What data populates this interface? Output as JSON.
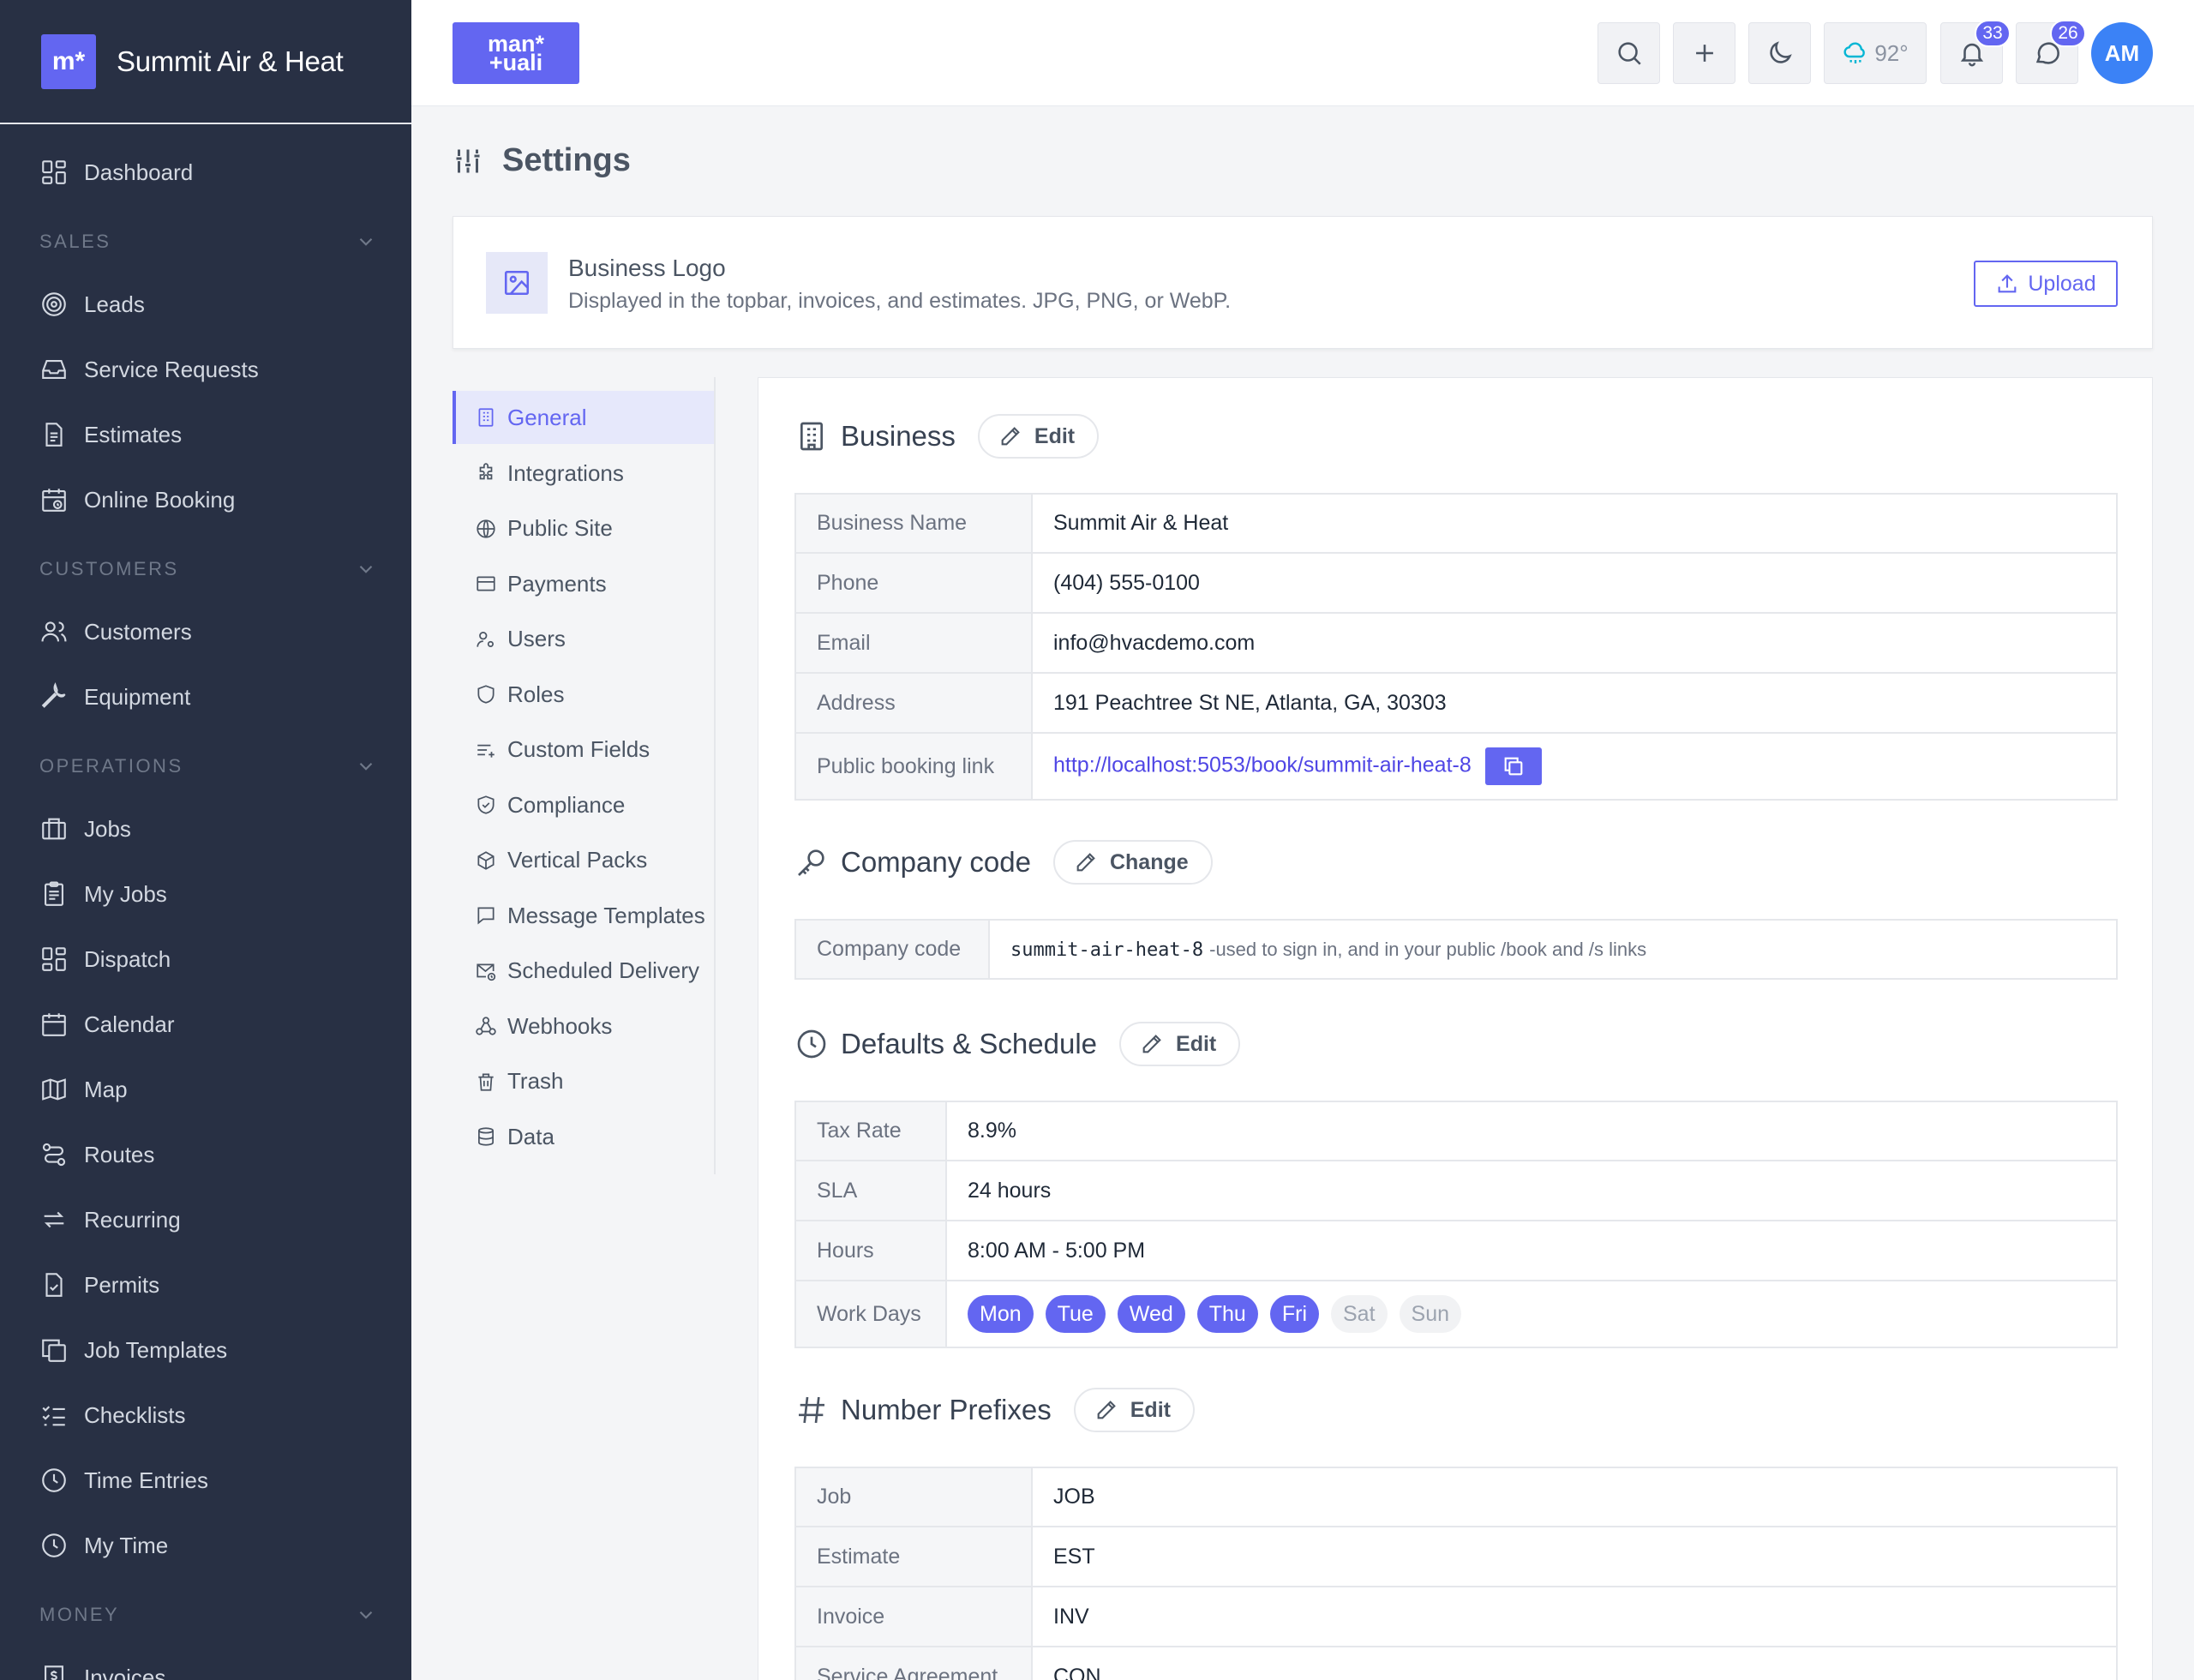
{
  "app": {
    "brand_mark": "m*",
    "brand_name": "Summit Air & Heat",
    "top_logo_line1": "man*",
    "top_logo_line2": "+uali"
  },
  "sidebar": {
    "dashboard": "Dashboard",
    "sections": {
      "sales": "SALES",
      "customers": "CUSTOMERS",
      "operations": "OPERATIONS",
      "money": "MONEY"
    },
    "sales_items": [
      "Leads",
      "Service Requests",
      "Estimates",
      "Online Booking"
    ],
    "customers_items": [
      "Customers",
      "Equipment"
    ],
    "operations_items": [
      "Jobs",
      "My Jobs",
      "Dispatch",
      "Calendar",
      "Map",
      "Routes",
      "Recurring",
      "Permits",
      "Job Templates",
      "Checklists",
      "Time Entries",
      "My Time"
    ],
    "money_items": [
      "Invoices"
    ]
  },
  "topbar": {
    "weather": "92°",
    "notifications_count": "33",
    "messages_count": "26",
    "avatar_initials": "AM"
  },
  "page": {
    "title": "Settings"
  },
  "logo_card": {
    "title": "Business Logo",
    "description": "Displayed in the topbar, invoices, and estimates. JPG, PNG, or WebP.",
    "upload_label": "Upload"
  },
  "settings_nav": [
    "General",
    "Integrations",
    "Public Site",
    "Payments",
    "Users",
    "Roles",
    "Custom Fields",
    "Compliance",
    "Vertical Packs",
    "Message Templates",
    "Scheduled Delivery",
    "Webhooks",
    "Trash",
    "Data"
  ],
  "business": {
    "title": "Business",
    "edit_label": "Edit",
    "rows": [
      {
        "label": "Business Name",
        "value": "Summit Air & Heat"
      },
      {
        "label": "Phone",
        "value": "(404) 555-0100"
      },
      {
        "label": "Email",
        "value": "info@hvacdemo.com"
      },
      {
        "label": "Address",
        "value": "191 Peachtree St NE, Atlanta, GA, 30303"
      },
      {
        "label": "Public booking link",
        "value": "http://localhost:5053/book/summit-air-heat-8"
      }
    ]
  },
  "company_code": {
    "title": "Company code",
    "change_label": "Change",
    "label": "Company code",
    "code": "summit-air-heat-8",
    "note": "-used to sign in, and in your public /book and /s links"
  },
  "defaults": {
    "title": "Defaults & Schedule",
    "edit_label": "Edit",
    "rows": [
      {
        "label": "Tax Rate",
        "value": "8.9%"
      },
      {
        "label": "SLA",
        "value": "24 hours"
      },
      {
        "label": "Hours",
        "value": "8:00 AM - 5:00 PM"
      },
      {
        "label": "Work Days",
        "value": ""
      }
    ],
    "work_days": [
      {
        "name": "Mon",
        "active": true
      },
      {
        "name": "Tue",
        "active": true
      },
      {
        "name": "Wed",
        "active": true
      },
      {
        "name": "Thu",
        "active": true
      },
      {
        "name": "Fri",
        "active": true
      },
      {
        "name": "Sat",
        "active": false
      },
      {
        "name": "Sun",
        "active": false
      }
    ]
  },
  "prefixes": {
    "title": "Number Prefixes",
    "edit_label": "Edit",
    "rows": [
      {
        "label": "Job",
        "value": "JOB"
      },
      {
        "label": "Estimate",
        "value": "EST"
      },
      {
        "label": "Invoice",
        "value": "INV"
      },
      {
        "label": "Service Agreement",
        "value": "CON"
      }
    ]
  }
}
